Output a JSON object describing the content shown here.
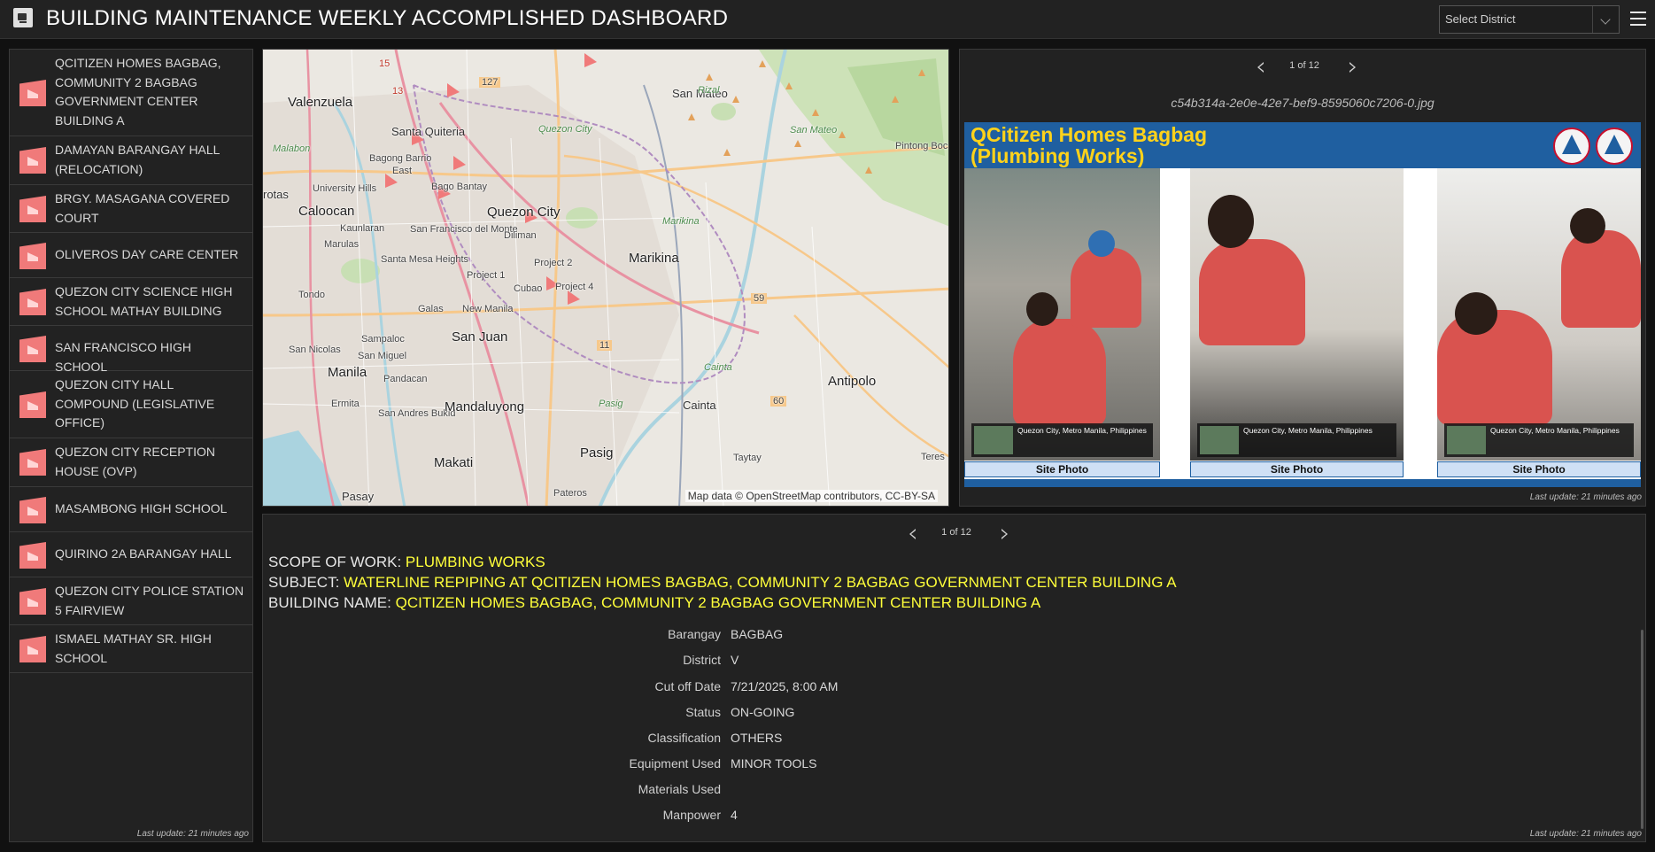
{
  "header": {
    "title": "BUILDING MAINTENANCE WEEKLY ACCOMPLISHED DASHBOARD",
    "district_select_placeholder": "Select District"
  },
  "sidebar": {
    "items": [
      {
        "label": "QCITIZEN HOMES BAGBAG, COMMUNITY 2 BAGBAG GOVERNMENT CENTER BUILDING A"
      },
      {
        "label": "DAMAYAN BARANGAY HALL (RELOCATION)"
      },
      {
        "label": "BRGY. MASAGANA COVERED COURT"
      },
      {
        "label": "OLIVEROS DAY CARE CENTER"
      },
      {
        "label": "QUEZON CITY SCIENCE HIGH SCHOOL MATHAY BUILDING"
      },
      {
        "label": "SAN FRANCISCO HIGH SCHOOL"
      },
      {
        "label": "QUEZON CITY HALL COMPOUND (LEGISLATIVE OFFICE)"
      },
      {
        "label": "QUEZON CITY RECEPTION HOUSE (OVP)"
      },
      {
        "label": "MASAMBONG HIGH SCHOOL"
      },
      {
        "label": "QUIRINO 2A BARANGAY HALL"
      },
      {
        "label": "QUEZON CITY POLICE STATION 5 FAIRVIEW"
      },
      {
        "label": "ISMAEL MATHAY SR. HIGH SCHOOL"
      }
    ],
    "last_update": "Last update: 21 minutes ago"
  },
  "map": {
    "labels": {
      "valenzuela": "Valenzuela",
      "san_mateo": "San Mateo",
      "rizal": "Rizal",
      "malabon": "Malabon",
      "santa_quiteria": "Santa Quiteria",
      "quezon_city_sm": "Quezon City",
      "san_mateo_sm": "San Mateo",
      "pintong_bocaue": "Pintong Bocaue",
      "bagong_barrio": "Bagong Barrio",
      "east": "East",
      "bago_bantay": "Bago Bantay",
      "university_hills": "University Hills",
      "rotas": "rotas",
      "caloocan": "Caloocan",
      "quezon_city": "Quezon City",
      "kaunlaran": "Kaunlaran",
      "marulas": "Marulas",
      "san_francisco_del_monte": "San Francisco del Monte",
      "diliman": "Diliman",
      "marikina_sm": "Marikina",
      "marikina": "Marikina",
      "santa_mesa_heights": "Santa Mesa Heights",
      "project_2": "Project 2",
      "project_1": "Project 1",
      "cubao": "Cubao",
      "project_4": "Project 4",
      "tondo": "Tondo",
      "galas": "Galas",
      "new_manila": "New Manila",
      "sampaloc": "Sampaloc",
      "san_juan": "San Juan",
      "san_nicolas": "San Nicolas",
      "san_miguel": "San Miguel",
      "manila": "Manila",
      "pandacan": "Pandacan",
      "cainta_sm": "Cainta",
      "antipolo": "Antipolo",
      "ermita": "Ermita",
      "san_andres_bukid": "San Andres Bukid",
      "mandaluyong": "Mandaluyong",
      "pasig_sm": "Pasig",
      "cainta": "Cainta",
      "pasig": "Pasig",
      "taytay": "Taytay",
      "makati": "Makati",
      "teres": "Teres",
      "pasay": "Pasay",
      "pateros": "Pateros",
      "road_127": "127",
      "road_59": "59",
      "road_11": "11",
      "road_60": "60",
      "road_15": "15",
      "road_13": "13"
    },
    "attribution": "Map data © OpenStreetMap contributors, CC-BY-SA",
    "marker_color": "#f07a7a"
  },
  "media": {
    "pager_text": "1 of 12",
    "filename": "c54b314a-2e0e-42e7-bef9-8595060c7206-0.jpg",
    "attachment_title_line1": "QCitizen Homes Bagbag",
    "attachment_title_line2": "(Plumbing Works)",
    "photos": [
      {
        "caption": "Site Photo",
        "geo_place": "Quezon City, Metro Manila, Philippines"
      },
      {
        "caption": "Site Photo",
        "geo_place": "Quezon City, Metro Manila, Philippines"
      },
      {
        "caption": "Site Photo",
        "geo_place": "Quezon City, Metro Manila, Philippines"
      }
    ],
    "last_update": "Last update: 21 minutes ago"
  },
  "details": {
    "pager_text": "1 of 12",
    "scope_label": "SCOPE OF WORK:",
    "scope_value": "PLUMBING WORKS",
    "subject_label": "SUBJECT:",
    "subject_value": "WATERLINE REPIPING AT QCITIZEN HOMES BAGBAG, COMMUNITY 2 BAGBAG GOVERNMENT CENTER BUILDING A",
    "building_label": "BUILDING NAME:",
    "building_value": "QCITIZEN HOMES BAGBAG, COMMUNITY 2 BAGBAG GOVERNMENT CENTER BUILDING A",
    "fields": [
      {
        "key": "Barangay",
        "value": "BAGBAG"
      },
      {
        "key": "District",
        "value": "V"
      },
      {
        "key": "Cut off Date",
        "value": "7/21/2025, 8:00 AM"
      },
      {
        "key": "Status",
        "value": "ON-GOING"
      },
      {
        "key": "Classification",
        "value": "OTHERS"
      },
      {
        "key": "Equipment Used",
        "value": "MINOR TOOLS"
      },
      {
        "key": "Materials Used",
        "value": ""
      },
      {
        "key": "Manpower",
        "value": "4"
      }
    ],
    "last_update": "Last update: 21 minutes ago"
  },
  "colors": {
    "highlight_yellow": "#ffff3a",
    "marker_red": "#f07a7a",
    "panel_bg": "#222222"
  }
}
